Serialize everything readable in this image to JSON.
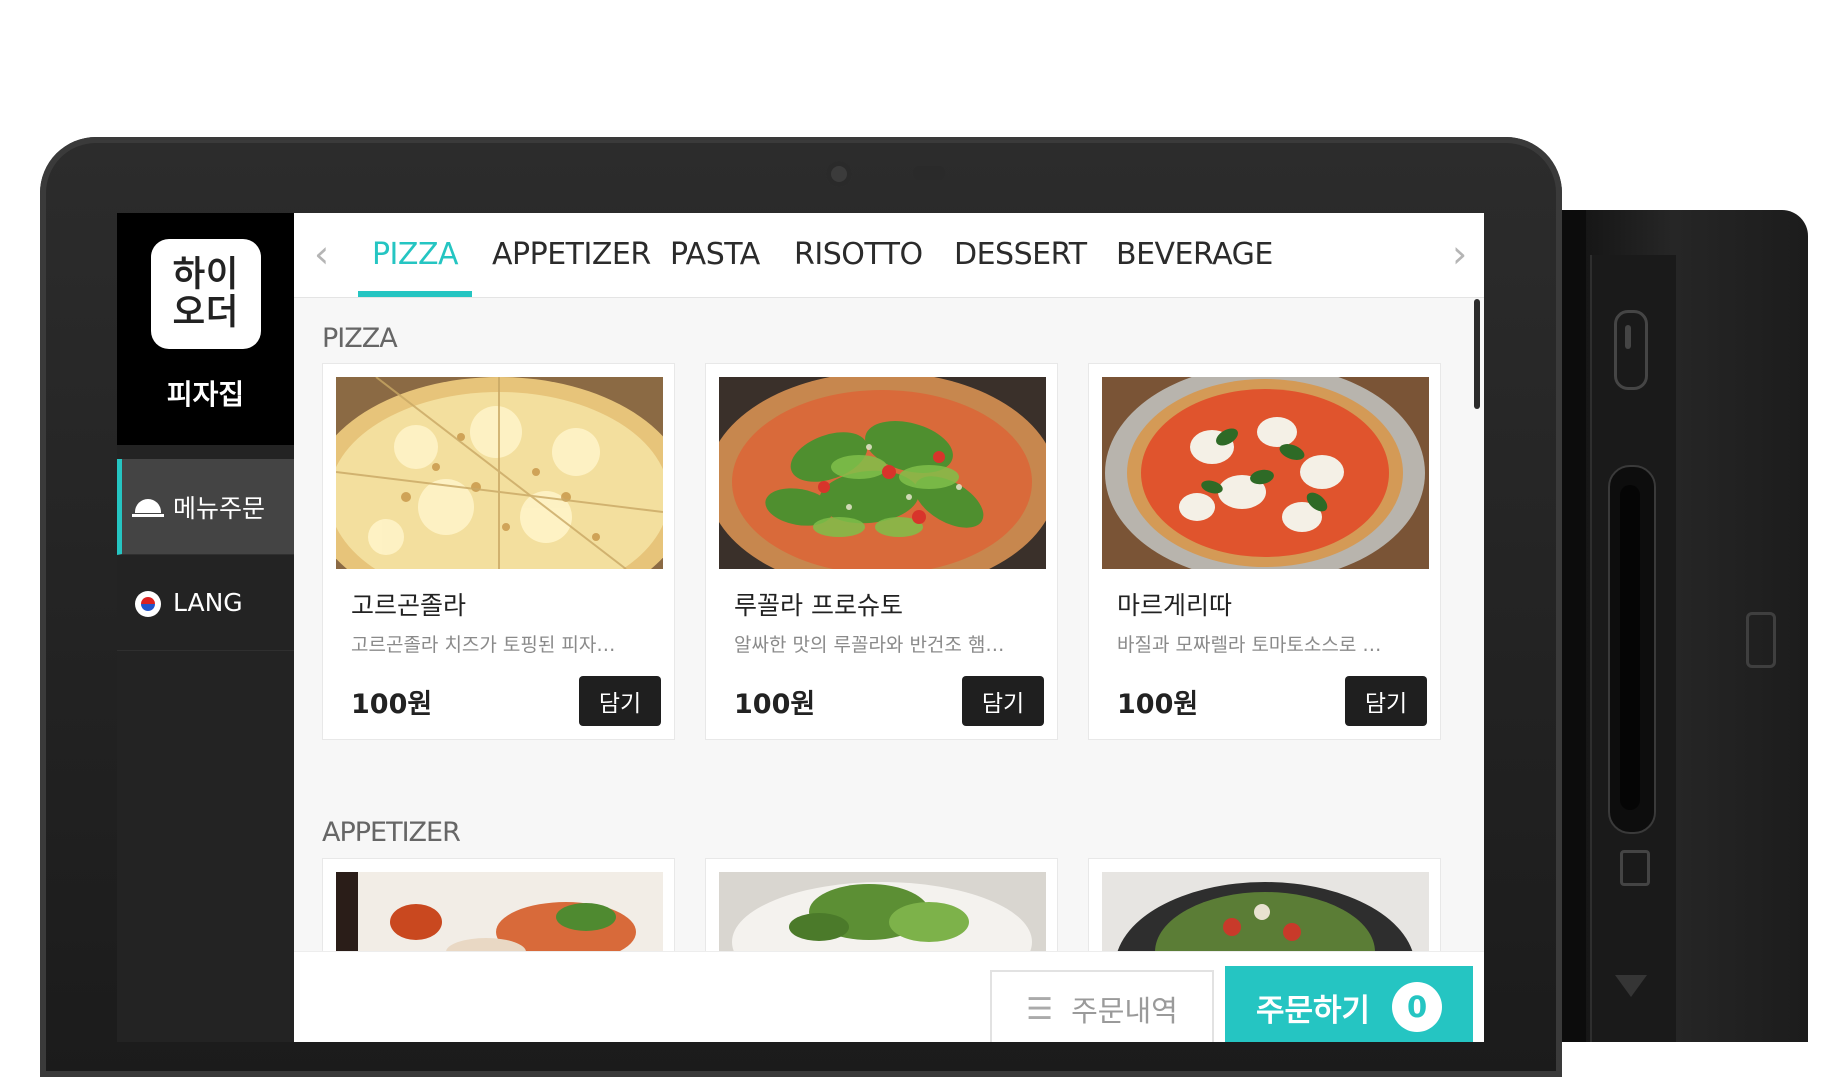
{
  "store": {
    "logo_line1": "하이",
    "logo_line2": "오더",
    "name": "피자집"
  },
  "sidebar": {
    "items": [
      {
        "label": "메뉴주문",
        "icon": "cloche-icon",
        "active": true
      },
      {
        "label": "LANG",
        "icon": "korea-flag-icon",
        "active": false
      }
    ]
  },
  "tabs": [
    {
      "label": "PIZZA",
      "active": true
    },
    {
      "label": "APPETIZER",
      "active": false
    },
    {
      "label": "PASTA",
      "active": false
    },
    {
      "label": "RISOTTO",
      "active": false
    },
    {
      "label": "DESSERT",
      "active": false
    },
    {
      "label": "BEVERAGE",
      "active": false
    }
  ],
  "sections": [
    {
      "title": "PIZZA",
      "items": [
        {
          "name": "고르곤졸라",
          "desc": "고르곤졸라 치즈가 토핑된 피자…",
          "price": "100원",
          "add": "담기"
        },
        {
          "name": "루꼴라 프로슈토",
          "desc": "알싸한 맛의 루꼴라와 반건조 햄…",
          "price": "100원",
          "add": "담기"
        },
        {
          "name": "마르게리따",
          "desc": "바질과 모짜렐라 토마토소스로 …",
          "price": "100원",
          "add": "담기"
        }
      ]
    },
    {
      "title": "APPETIZER"
    }
  ],
  "footer": {
    "history_label": "주문내역",
    "order_label": "주문하기",
    "cart_count": "0"
  },
  "colors": {
    "accent": "#25c5c2",
    "sidebar_bg": "#232323",
    "button_dark": "#1f1f1f"
  }
}
